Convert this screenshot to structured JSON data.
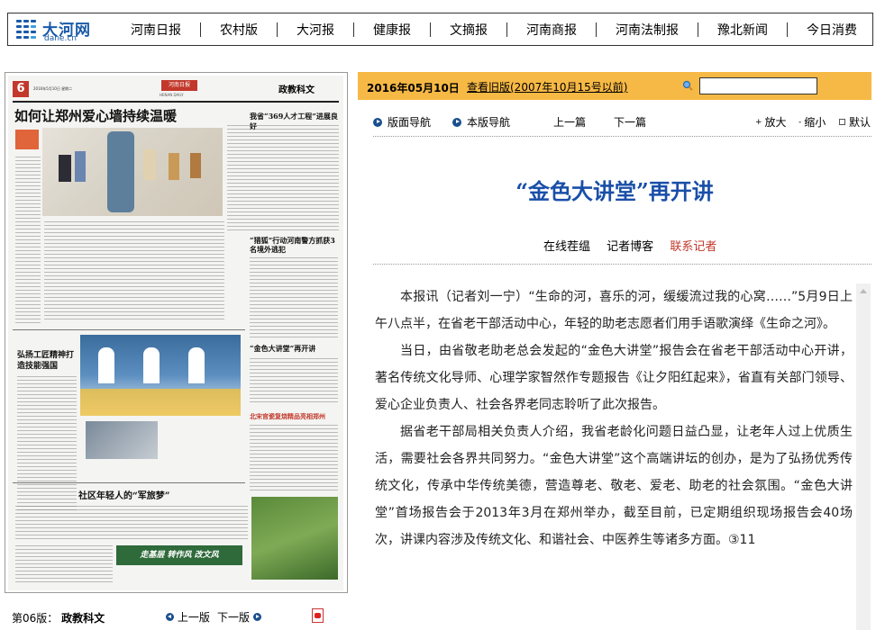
{
  "site": {
    "logo_cn": "大河网",
    "logo_en": "dahe.cn"
  },
  "nav": [
    {
      "label": "河南日报"
    },
    {
      "label": "农村版"
    },
    {
      "label": "大河报"
    },
    {
      "label": "健康报"
    },
    {
      "label": "文摘报"
    },
    {
      "label": "河南商报"
    },
    {
      "label": "河南法制报"
    },
    {
      "label": "豫北新闻"
    },
    {
      "label": "今日消费"
    }
  ],
  "newspaper": {
    "page_no": "6",
    "date_line": "2016年5月10日 星期二",
    "masthead": "河南日报",
    "masthead_en": "HENAN DAILY",
    "section": "政教科文",
    "headline": "如何让郑州爱心墙持续温暖",
    "story2": "“猎狐”行动河南警方抓获3名境外逃犯",
    "story3": "弘扬工匠精神打造技能强国",
    "story4": "“金色大讲堂”再开讲",
    "story5": "北宋官瓷复烧精品亮相郑州",
    "story6": "社区年轻人的“军旅梦”",
    "story7": "我省“369人才工程”进展良好",
    "banner": "走基层 转作风 改文风"
  },
  "page_footer": {
    "edition": "第06版：",
    "section": "政教科文",
    "prev": "上一版",
    "next": "下一版"
  },
  "datebar": {
    "date": "2016年05月10日",
    "old_link": "查看旧版(2007年10月15号以前)",
    "search_value": ""
  },
  "toolbar": {
    "page_nav": "版面导航",
    "section_nav": "本版导航",
    "prev": "上一篇",
    "next": "下一篇",
    "zoom_in": "放大",
    "zoom_out": "缩小",
    "default": "默认"
  },
  "article": {
    "title": "“金色大讲堂”再开讲",
    "meta": {
      "forum": "在线茬缊",
      "blog": "记者博客",
      "contact": "联系记者"
    },
    "paragraphs": [
      "本报讯（记者刘一宁）“生命的河，喜乐的河，缓缓流过我的心窝……”5月9日上午八点半，在省老干部活动中心，年轻的助老志愿者们用手语歌演绎《生命之河》。",
      "当日，由省敬老助老总会发起的“金色大讲堂”报告会在省老干部活动中心开讲，著名传统文化导师、心理学家智然作专题报告《让夕阳红起来》，省直有关部门领导、爱心企业负责人、社会各界老同志聆听了此次报告。",
      "据省老干部局相关负责人介绍，我省老龄化问题日益凸显，让老年人过上优质生活，需要社会各界共同努力。“金色大讲堂”这个高端讲坛的创办，是为了弘扬优秀传统文化，传承中华传统美德，营造尊老、敬老、爱老、助老的社会氛围。“金色大讲堂”首场报告会于2013年3月在郑州举办，截至目前，已定期组织现场报告会40场次，讲课内容涉及传统文化、和谐社会、中医养生等诸多方面。③11"
    ]
  },
  "colors": {
    "datebar": "#f7b945",
    "title": "#1a4fa8",
    "contact": "#c2382b",
    "nav_icon": "#1a4f8f"
  },
  "icons": [
    "logo-icon",
    "search-icon",
    "arrow-right-icon",
    "plus-icon",
    "minus-icon",
    "square-icon",
    "pdf-icon",
    "scroll-up-icon"
  ]
}
